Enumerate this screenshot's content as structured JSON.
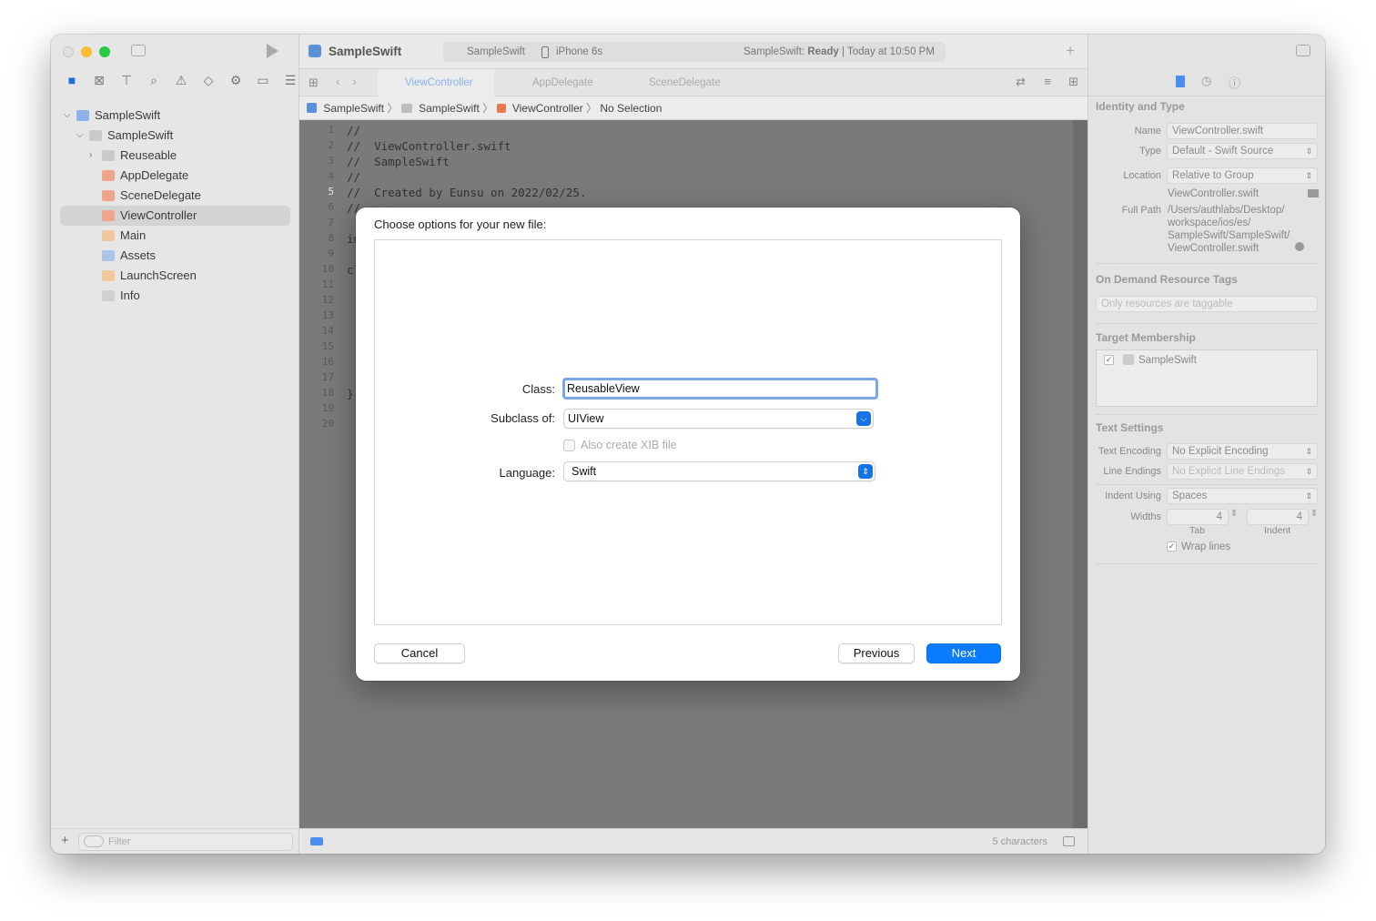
{
  "toolbar": {
    "project_name": "SampleSwift",
    "scheme": "SampleSwift",
    "device": "iPhone 6s",
    "status_prefix": "SampleSwift: ",
    "status_state": "Ready",
    "status_time": " | Today at 10:50 PM"
  },
  "tabs": [
    "ViewController",
    "AppDelegate",
    "SceneDelegate"
  ],
  "jumpbar": [
    "SampleSwift",
    "SampleSwift",
    "ViewController",
    "No Selection"
  ],
  "navigator": {
    "items": [
      {
        "label": "SampleSwift",
        "level": 0
      },
      {
        "label": "SampleSwift",
        "level": 1
      },
      {
        "label": "Reuseable",
        "level": 2
      },
      {
        "label": "AppDelegate",
        "level": 2
      },
      {
        "label": "SceneDelegate",
        "level": 2
      },
      {
        "label": "ViewController",
        "level": 2
      },
      {
        "label": "Main",
        "level": 2
      },
      {
        "label": "Assets",
        "level": 2
      },
      {
        "label": "LaunchScreen",
        "level": 2
      },
      {
        "label": "Info",
        "level": 2
      }
    ],
    "filter_placeholder": "Filter"
  },
  "code": {
    "lines": [
      "//",
      "//  ViewController.swift",
      "//  SampleSwift",
      "//",
      "//  Created by Eunsu on 2022/02/25.",
      "//",
      "",
      "in",
      "",
      "cl",
      "",
      "",
      "",
      "",
      "",
      "",
      "",
      "}",
      "",
      ""
    ],
    "line_numbers": [
      "1",
      "2",
      "3",
      "4",
      "5",
      "6",
      "7",
      "8",
      "9",
      "10",
      "11",
      "12",
      "13",
      "14",
      "15",
      "16",
      "17",
      "18",
      "19",
      "20"
    ]
  },
  "statusbar": {
    "char_count": "5 characters"
  },
  "inspector": {
    "identity_title": "Identity and Type",
    "name_label": "Name",
    "name_value": "ViewController.swift",
    "type_label": "Type",
    "type_value": "Default - Swift Source",
    "location_label": "Location",
    "location_value": "Relative to Group",
    "location_file": "ViewController.swift",
    "fullpath_label": "Full Path",
    "fullpath_lines": [
      "/Users/authlabs/Desktop/",
      "workspace/ios/es/",
      "SampleSwift/SampleSwift/",
      "ViewController.swift"
    ],
    "ondemand_title": "On Demand Resource Tags",
    "ondemand_placeholder": "Only resources are taggable",
    "target_title": "Target Membership",
    "target_item": "SampleSwift",
    "text_title": "Text Settings",
    "encoding_label": "Text Encoding",
    "encoding_value": "No Explicit Encoding",
    "endings_label": "Line Endings",
    "endings_value": "No Explicit Line Endings",
    "indent_label": "Indent Using",
    "indent_value": "Spaces",
    "widths_label": "Widths",
    "tab_value": "4",
    "indent_width_value": "4",
    "tab_caption": "Tab",
    "indent_caption": "Indent",
    "wrap_label": "Wrap lines"
  },
  "sheet": {
    "title": "Choose options for your new file:",
    "class_label": "Class:",
    "class_value": "ReusableView",
    "subclass_label": "Subclass of:",
    "subclass_value": "UIView",
    "xib_label": "Also create XIB file",
    "language_label": "Language:",
    "language_value": "Swift",
    "cancel": "Cancel",
    "previous": "Previous",
    "next": "Next"
  },
  "colors": {
    "accent": "#0a7cff",
    "selection": "#7aa7e6"
  }
}
